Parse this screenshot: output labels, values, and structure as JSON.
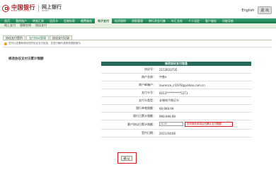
{
  "header": {
    "bank_name_cn": "中国银行",
    "bank_name_en": "BANK OF CHINA",
    "product_cn": "网上银行",
    "product_en": "BOCNET",
    "language": "English",
    "logout_label": "退 出"
  },
  "main_nav": {
    "items": [
      {
        "label": "首页"
      },
      {
        "label": "我的账户"
      },
      {
        "label": "转账汇款"
      },
      {
        "label": "信用卡"
      },
      {
        "label": "定期存款"
      },
      {
        "label": "缴费服务"
      },
      {
        "label": "电子支付"
      },
      {
        "label": "投资理财"
      },
      {
        "label": "贷款管理"
      },
      {
        "label": "跨行资金归集"
      },
      {
        "label": "外汇业务"
      },
      {
        "label": "个人设定"
      },
      {
        "label": "客户服务"
      },
      {
        "label": "功能导航"
      }
    ],
    "active_index": 6
  },
  "sub_nav": {
    "items": [
      {
        "label": "网上支付"
      },
      {
        "label": "银联在线"
      },
      {
        "label": "协议支付"
      }
    ]
  },
  "tabs": [
    {
      "label": "协议支付签约"
    },
    {
      "label": "支付协议管理"
    },
    {
      "label": "协议支付记录"
    }
  ],
  "notice": {
    "icon": "info-icon",
    "text": "您可以查看和修改您的协议支付信息，并进行解约或修改限额操作。"
  },
  "section_title": "修改协议支付日累计限额",
  "panel": {
    "title": "修改协议支付信息",
    "rows": [
      {
        "label": "协议号：",
        "value": "2153910735"
      },
      {
        "label": "商户名称：",
        "value": "中铁e"
      },
      {
        "label": "商户邮箱户：",
        "value": "laurence_cl1978@yahoo.com.cn"
      },
      {
        "label": "支付卡号：",
        "value": "6013**********5271"
      },
      {
        "label": "支付卡类型：",
        "value": "长城电子借记卡"
      },
      {
        "label": "银行单笔限额：",
        "value": "99,999.99"
      },
      {
        "label": "银行日累计限额：",
        "value": "999,999.99"
      }
    ],
    "limit_row": {
      "label": "客户协议日累计限额：",
      "input_value": "30.00",
      "hint": "您可修改本协议日累计支付限额"
    },
    "sign_row": {
      "label": "签约日期：",
      "value": "2011/04/06"
    }
  },
  "confirm_label": "确 认"
}
